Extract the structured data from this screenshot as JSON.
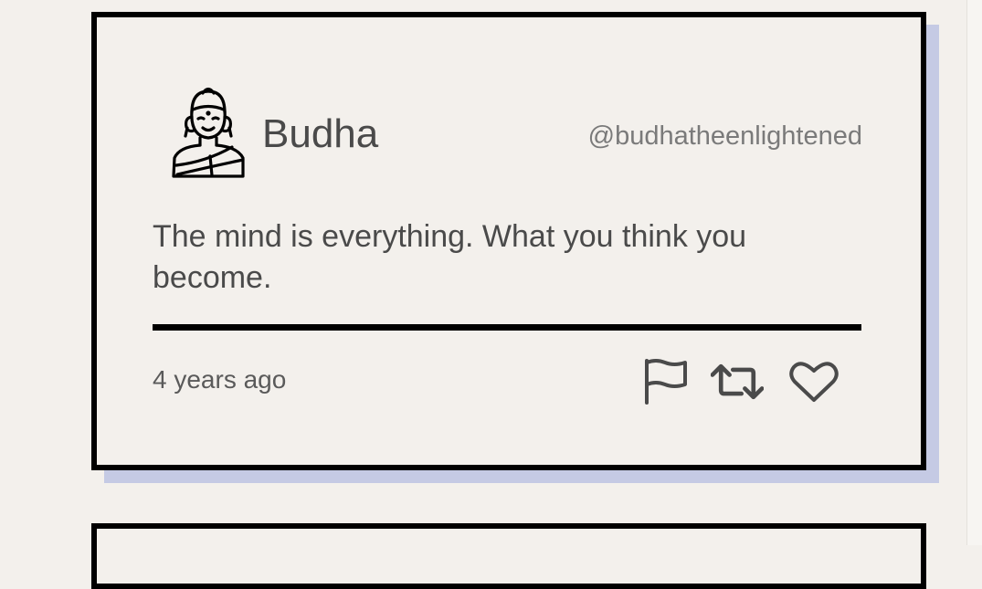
{
  "tweet": {
    "author_name": "Budha",
    "author_handle": "@budhatheenlightened",
    "text": "The mind is everything. What you think you become.",
    "timestamp": "4 years ago",
    "avatar_icon": "buddha-icon",
    "actions": [
      {
        "icon": "flag-icon"
      },
      {
        "icon": "retweet-icon"
      },
      {
        "icon": "heart-icon"
      }
    ]
  },
  "colors": {
    "background": "#f3f0ec",
    "border": "#000000",
    "shadow": "#c5cae4",
    "text": "#4a4a4a",
    "handle": "#7a7a7a"
  }
}
